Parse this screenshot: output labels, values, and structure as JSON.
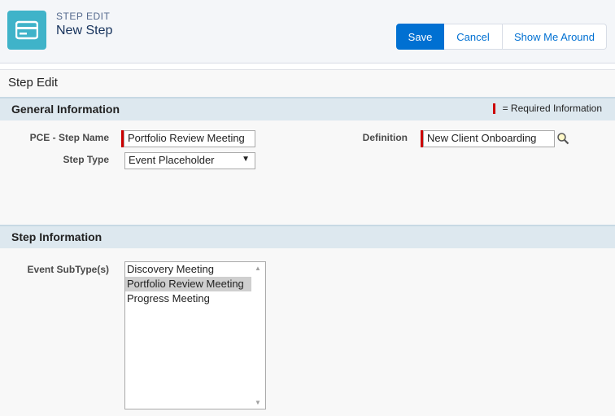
{
  "header": {
    "eyebrow": "STEP EDIT",
    "title": "New Step",
    "icon": "step-card-icon",
    "accent_color": "#3fb3c9",
    "buttons": {
      "save": "Save",
      "cancel": "Cancel",
      "show_me_around": "Show Me Around"
    }
  },
  "panel": {
    "title": "Step Edit"
  },
  "general_section": {
    "title": "General Information",
    "required_legend": "= Required Information",
    "fields": {
      "step_name_label": "PCE - Step Name",
      "step_name_value": "Portfolio Review Meeting",
      "step_type_label": "Step Type",
      "step_type_value": "Event Placeholder",
      "definition_label": "Definition",
      "definition_value": "New Client Onboarding",
      "lookup_icon": "magnifier-icon"
    }
  },
  "step_section": {
    "title": "Step Information",
    "subtype_label": "Event SubType(s)",
    "subtype_options": [
      "Discovery Meeting",
      "Portfolio Review Meeting",
      "Progress Meeting"
    ],
    "subtype_selected": "Portfolio Review Meeting"
  },
  "colors": {
    "primary_button": "#0070d2",
    "required": "#cc0000",
    "section_bar": "#dde8ef"
  }
}
